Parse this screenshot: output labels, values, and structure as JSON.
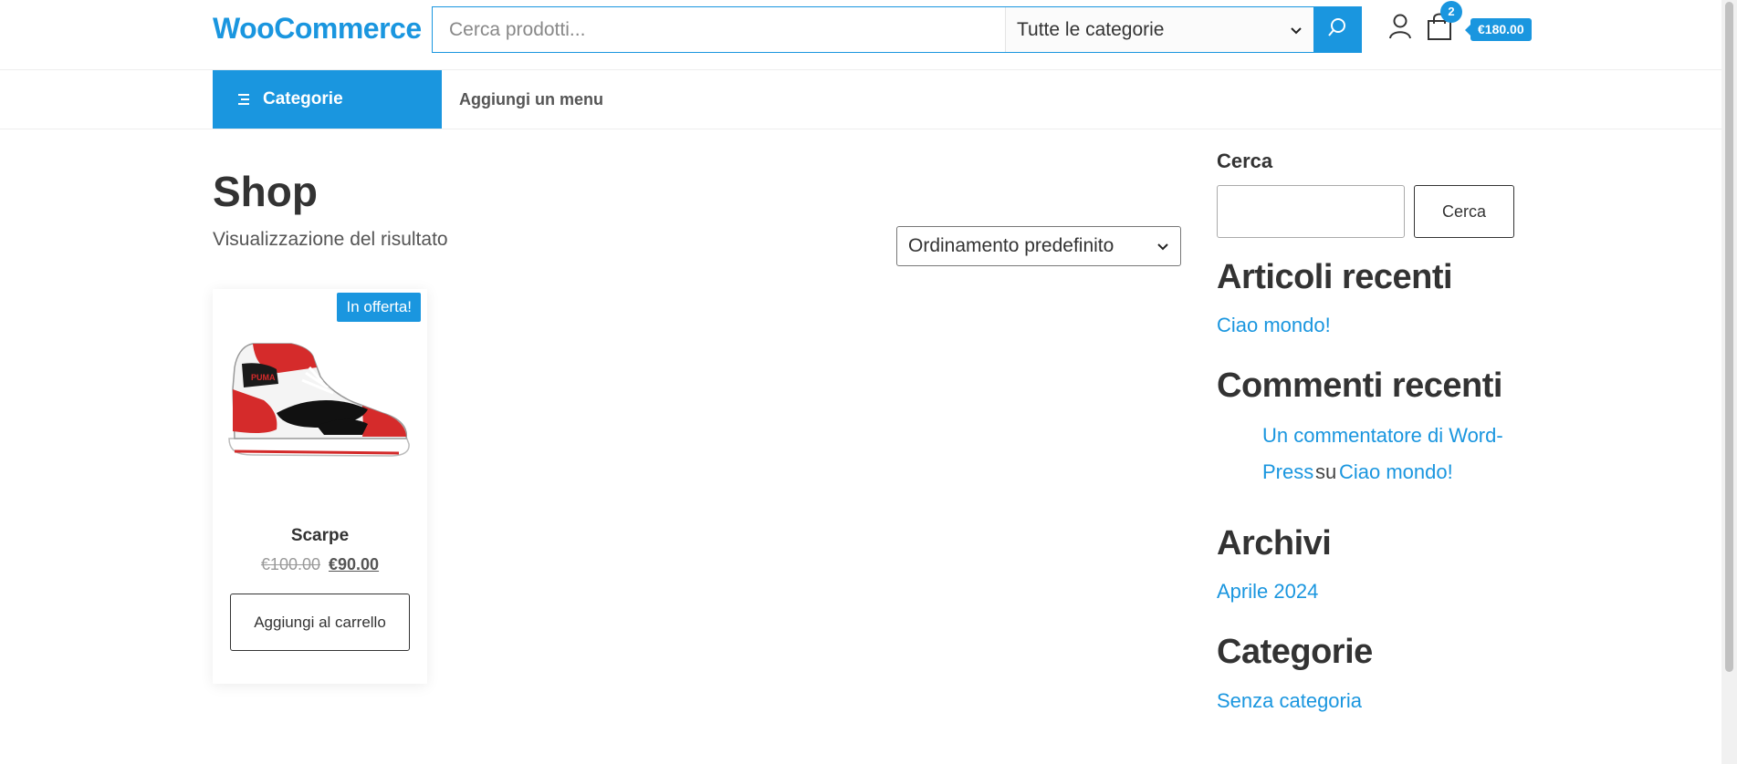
{
  "header": {
    "logo": "WooCommerce",
    "search_placeholder": "Cerca prodotti...",
    "category_select": "Tutte le categorie",
    "cart_count": "2",
    "cart_total": "€180.00",
    "search_icon": "search-icon",
    "user_icon": "user-icon",
    "cart_icon": "shopping-bag-icon"
  },
  "nav": {
    "categories_label": "Categorie",
    "add_menu_label": "Aggiungi un menu"
  },
  "main": {
    "title": "Shop",
    "result_count": "Visualizzazione del risultato",
    "orderby": "Ordinamento predefinito",
    "products": [
      {
        "badge": "In offerta!",
        "name": "Scarpe",
        "old_price": "€100.00",
        "new_price": "€90.00",
        "button": "Aggiungi al carrello"
      }
    ]
  },
  "sidebar": {
    "search_label": "Cerca",
    "search_button": "Cerca",
    "recent_posts_title": "Articoli recenti",
    "recent_posts": [
      "Ciao mondo!"
    ],
    "recent_comments_title": "Commenti recenti",
    "comment_author": "Un commentatore di Word-",
    "comment_author_2": "Press",
    "comment_on": "su",
    "comment_post": "Ciao mondo!",
    "archives_title": "Archivi",
    "archives": [
      "Aprile 2024"
    ],
    "categories_title": "Categorie",
    "categories": [
      "Senza categoria"
    ]
  },
  "colors": {
    "accent": "#1a96df"
  }
}
